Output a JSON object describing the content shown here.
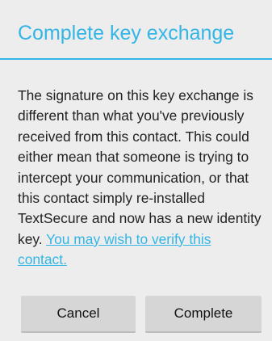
{
  "dialog": {
    "title": "Complete key exchange",
    "message_text": "The signature on this key exchange is different than what you've previously received from this contact. This could either mean that someone is trying to intercept your communication, or that this contact simply re-installed TextSecure and now has a new identity key. ",
    "link_text": "You may wish to verify this contact.",
    "buttons": {
      "cancel_label": "Cancel",
      "complete_label": "Complete"
    }
  },
  "colors": {
    "accent": "#33b5e5",
    "background": "#ededed",
    "button": "#d6d6d6",
    "text": "#222222"
  }
}
